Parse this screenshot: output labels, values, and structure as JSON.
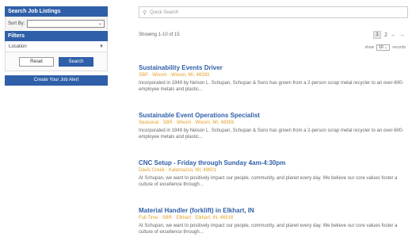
{
  "sidebar": {
    "header": "Search Job Listings",
    "sort_label": "Sort By:",
    "sort_value": "",
    "filters_header": "Filters",
    "location_label": "Location",
    "reset_label": "Reset",
    "search_label": "Search",
    "alert_label": "Create Your Job Alert"
  },
  "main": {
    "search_placeholder": "Quick Search",
    "showing": "Showing 1-10 of 15",
    "pagination": {
      "current": "1",
      "next_page": "2",
      "prev_arrow": "←",
      "next_arrow": "→"
    },
    "show_label": "show",
    "per_page": "10",
    "per_page_suffix": "records"
  },
  "jobs": [
    {
      "title": "Sustainability Events Driver",
      "meta": "SBP · Wixom · Wixom, MI, 48393",
      "desc": "Incorporated in 1949 by Nelson L. Schupan, Schupan & Sons has grown from a 2-person scrap metal recycler to an over-600-employee metals and plastic..."
    },
    {
      "title": "Sustainable Event Operations Specialist",
      "meta": "Seasonal · SBR · Wixom · Wixom, MI, 48393",
      "desc": "Incorporated in 1949 by Nelson L. Schupan, Schupan & Sons has grown from a 2-person scrap metal recycler to an over-600-employee metals and plastic..."
    },
    {
      "title": "CNC Setup - Friday through Sunday 4am-4:30pm",
      "meta": "Davis Creek · Kalamazoo, MI, 49001",
      "desc": "At Schupan, we want to positively impact our people, community, and planet every day. We believe our core values foster a culture of excellence through..."
    },
    {
      "title": "Material Handler (forklift) in Elkhart, IN",
      "meta": "Full Time · SBR · Elkhart · Elkhart, IN, 46516",
      "desc": "At Schupan, we want to positively impact our people, community, and planet every day. We believe our core values foster a culture of excellence through..."
    }
  ]
}
